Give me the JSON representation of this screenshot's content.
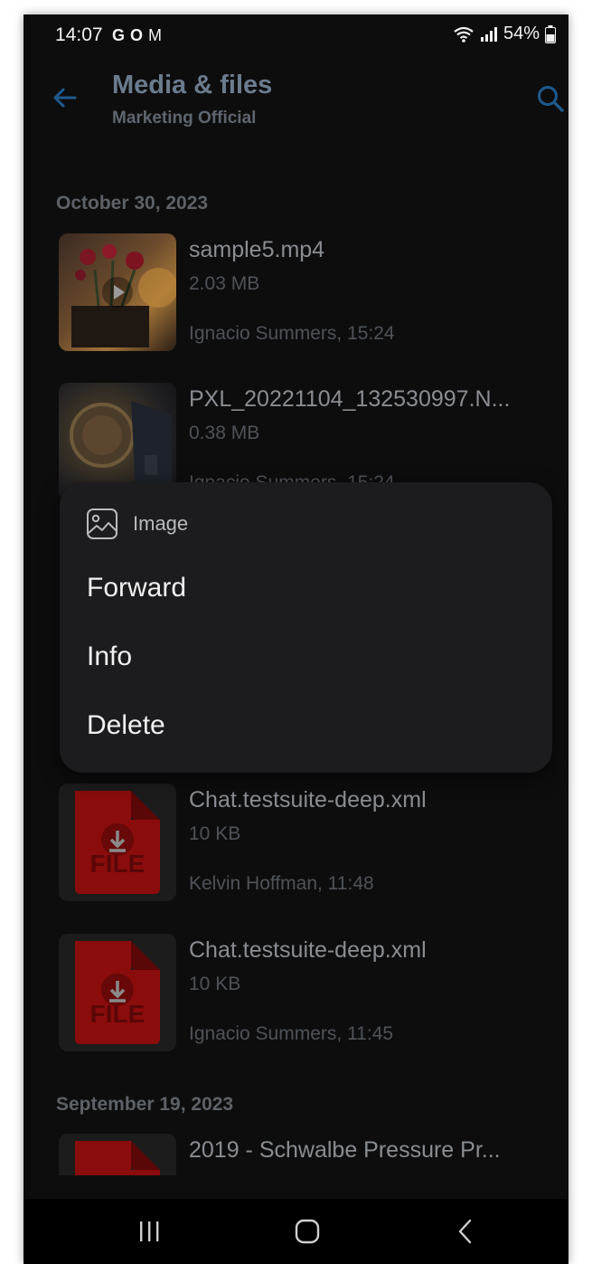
{
  "status_bar": {
    "time": "14:07",
    "notification_icons": [
      "G",
      "O",
      "M"
    ],
    "battery": "54%"
  },
  "app_bar": {
    "title": "Media & files",
    "subtitle": "Marketing Official",
    "accent_color": "#1e5a8c"
  },
  "sections": [
    {
      "date": "October 30, 2023",
      "items": [
        {
          "name": "sample5.mp4",
          "size": "2.03 MB",
          "meta": "Ignacio Summers, 15:24",
          "thumb": "video"
        },
        {
          "name": "PXL_20221104_132530997.N...",
          "size": "0.38 MB",
          "meta": "Ignacio Summers, 15:24",
          "thumb": "photo"
        }
      ]
    },
    {
      "date": "",
      "items": [
        {
          "name": "Chat.testsuite-deep.xml",
          "size": "10 KB",
          "meta": "Kelvin Hoffman, 11:48",
          "thumb": "file",
          "thumb_label": "FILE"
        },
        {
          "name": "Chat.testsuite-deep.xml",
          "size": "10 KB",
          "meta": "Ignacio Summers, 11:45",
          "thumb": "file",
          "thumb_label": "FILE"
        }
      ]
    },
    {
      "date": "September 19, 2023",
      "items": [
        {
          "name": "2019 - Schwalbe Pressure Pr...",
          "thumb": "file"
        }
      ]
    }
  ],
  "context_menu": {
    "header": "Image",
    "items": [
      "Forward",
      "Info",
      "Delete"
    ]
  },
  "colors": {
    "background": "#0d0d0d",
    "menu_background": "#1c1c1e",
    "file_icon_red": "#8b0c0c"
  }
}
